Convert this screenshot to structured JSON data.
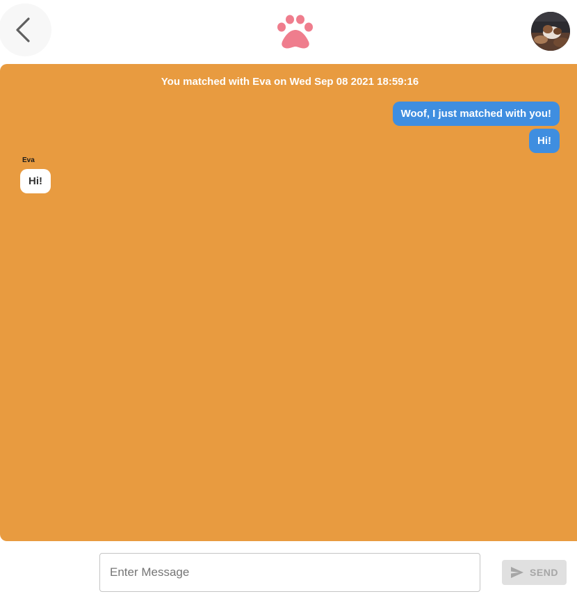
{
  "header": {
    "back_icon": "chevron-left-icon",
    "logo_icon": "paw-icon",
    "avatar_icon": "dog-profile-avatar"
  },
  "chat": {
    "match_banner": "You matched with Eva on Wed Sep 08 2021 18:59:16",
    "sender_name": "Eva",
    "messages": [
      {
        "direction": "sent",
        "text": "Woof, I just matched with you!"
      },
      {
        "direction": "sent",
        "text": "Hi!"
      },
      {
        "direction": "received",
        "text": "Hi!"
      }
    ]
  },
  "composer": {
    "placeholder": "Enter Message",
    "send_label": "SEND",
    "send_icon": "send-icon"
  },
  "colors": {
    "chat_background": "#e89b40",
    "sent_bubble": "#3f8ee0",
    "received_bubble": "#ffffff",
    "paw": "#ef7d8d"
  }
}
